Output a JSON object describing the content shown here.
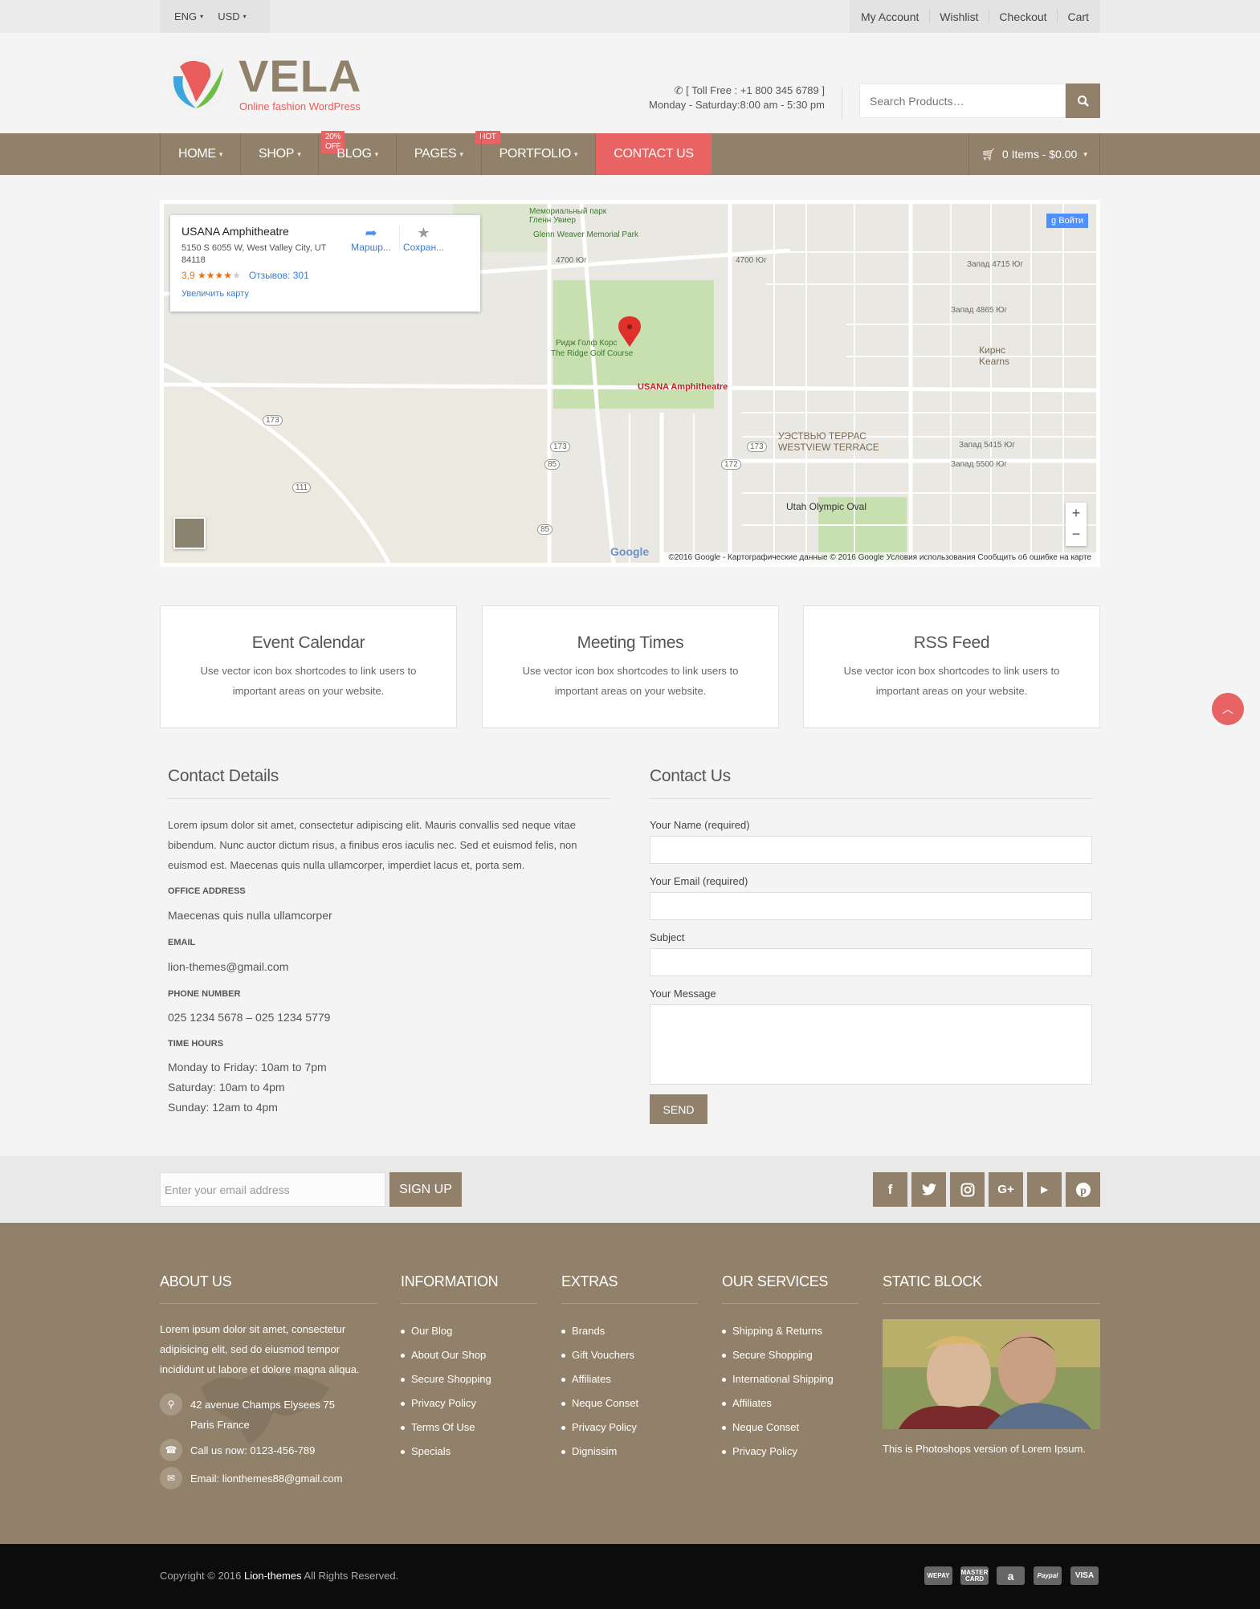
{
  "topbar": {
    "language": "ENG",
    "currency": "USD",
    "links": [
      "My Account",
      "Wishlist",
      "Checkout",
      "Cart"
    ]
  },
  "header": {
    "brand": "VELA",
    "tagline": "Online fashion WordPress",
    "toll_free": "[ Toll Free : +1 800 345 6789 ]",
    "hours": "Monday - Saturday:8:00 am - 5:30 pm",
    "search_placeholder": "Search Products…"
  },
  "nav": {
    "items": [
      "HOME",
      "SHOP",
      "BLOG",
      "PAGES",
      "PORTFOLIO",
      "CONTACT US"
    ],
    "badges": {
      "shop": "20% OFF",
      "blog": "HOT"
    },
    "cart": "0 Items - $0.00"
  },
  "map": {
    "place_name": "USANA Amphitheatre",
    "address": "5150 S 6055 W, West Valley City, UT 84118",
    "rating": "3,9",
    "stars": 4,
    "reviews": "Отзывов: 301",
    "enlarge": "Увеличить карту",
    "route": "Маршр...",
    "save": "Сохран...",
    "login": "Войти",
    "pin_label": "USANA Amphitheatre",
    "footer": "©2016 Google - Картографические данные © 2016 Google   Условия использования   Сообщить об ошибке на карте",
    "labels": {
      "golf": "Ридж Голф Корс",
      "golf_en": "The Ridge Golf Course",
      "park": "Мемориальный парк Гленн Увиер",
      "park_en": "Glenn Weaver Memorial Park",
      "kearns": "Кирнс Kearns",
      "westview": "УЭСТВЬЮ ТЕРРАС",
      "westview_en": "WESTVIEW TERRACE",
      "olympic": "Utah Olympic Oval",
      "r4700": "4700 Юг",
      "r4715": "Запад 4715 Юг",
      "r4865": "Запад 4865 Юг",
      "r5415": "Запад 5415 Юг",
      "r5500": "Запад 5500 Юг",
      "hw173": "173",
      "hw111": "111",
      "hw85": "85",
      "hw172": "172"
    }
  },
  "features": [
    {
      "title": "Event Calendar",
      "text": "Use  vector icon box shortcodes to link users to important areas on your website."
    },
    {
      "title": "Meeting Times",
      "text": "Use  vector icon box shortcodes to link users to important areas on your website."
    },
    {
      "title": "RSS Feed",
      "text": "Use  vector icon box shortcodes to link users to important areas on your website."
    }
  ],
  "contact_details": {
    "title": "Contact Details",
    "intro": "Lorem ipsum dolor sit amet, consectetur adipiscing elit. Mauris convallis sed neque vitae bibendum. Nunc auctor dictum risus, a finibus eros iaculis nec. Sed et euismod felis, non euismod est. Maecenas quis nulla ullamcorper, imperdiet lacus et, porta sem.",
    "office_label": "OFFICE ADDRESS",
    "office": "Maecenas quis nulla ullamcorper",
    "email_label": "EMAIL",
    "email": "lion-themes@gmail.com",
    "phone_label": "PHONE NUMBER",
    "phone": "025 1234 5678 – 025 1234 5779",
    "hours_label": "TIME HOURS",
    "hours": [
      "Monday to Friday: 10am to 7pm",
      "Saturday: 10am to 4pm",
      "Sunday: 12am to 4pm"
    ]
  },
  "contact_form": {
    "title": "Contact Us",
    "name_label": "Your Name (required)",
    "email_label": "Your Email (required)",
    "subject_label": "Subject",
    "message_label": "Your Message",
    "send": "SEND"
  },
  "newsletter": {
    "placeholder": "Enter your email address",
    "button": "SIGN UP",
    "social": [
      "facebook-icon",
      "twitter-icon",
      "instagram-icon",
      "google-plus-icon",
      "youtube-icon",
      "pinterest-icon"
    ]
  },
  "footer": {
    "about_title": "ABOUT US",
    "about_text": "Lorem ipsum dolor sit amet, consectetur adipisicing elit, sed do eiusmod tempor incididunt ut labore et dolore magna aliqua.",
    "address": "42 avenue Champs Elysees 75 Paris France",
    "call": "Call us now: 0123-456-789",
    "email": "Email: lionthemes88@gmail.com",
    "information_title": "INFORMATION",
    "information": [
      "Our Blog",
      "About Our Shop",
      "Secure Shopping",
      "Privacy Policy",
      "Terms Of Use",
      "Specials"
    ],
    "extras_title": "EXTRAS",
    "extras": [
      "Brands",
      "Gift Vouchers",
      "Affiliates",
      "Neque Conset",
      "Privacy Policy",
      "Dignissim"
    ],
    "services_title": "OUR SERVICES",
    "services": [
      "Shipping & Returns",
      "Secure Shopping",
      "International Shipping",
      "Affiliates",
      "Neque Conset",
      "Privacy Policy"
    ],
    "static_title": "STATIC BLOCK",
    "static_caption": "This is Photoshops version of Lorem Ipsum."
  },
  "bottom": {
    "copyright_pre": "Copyright © 2016 ",
    "copyright_brand": "Lion-themes",
    "copyright_post": " All Rights Reserved.",
    "payments": [
      "WEPAY",
      "MASTER CARD",
      "a",
      "Paypal",
      "VISA"
    ]
  },
  "colors": {
    "brand": "#91816b",
    "accent": "#e86363"
  }
}
